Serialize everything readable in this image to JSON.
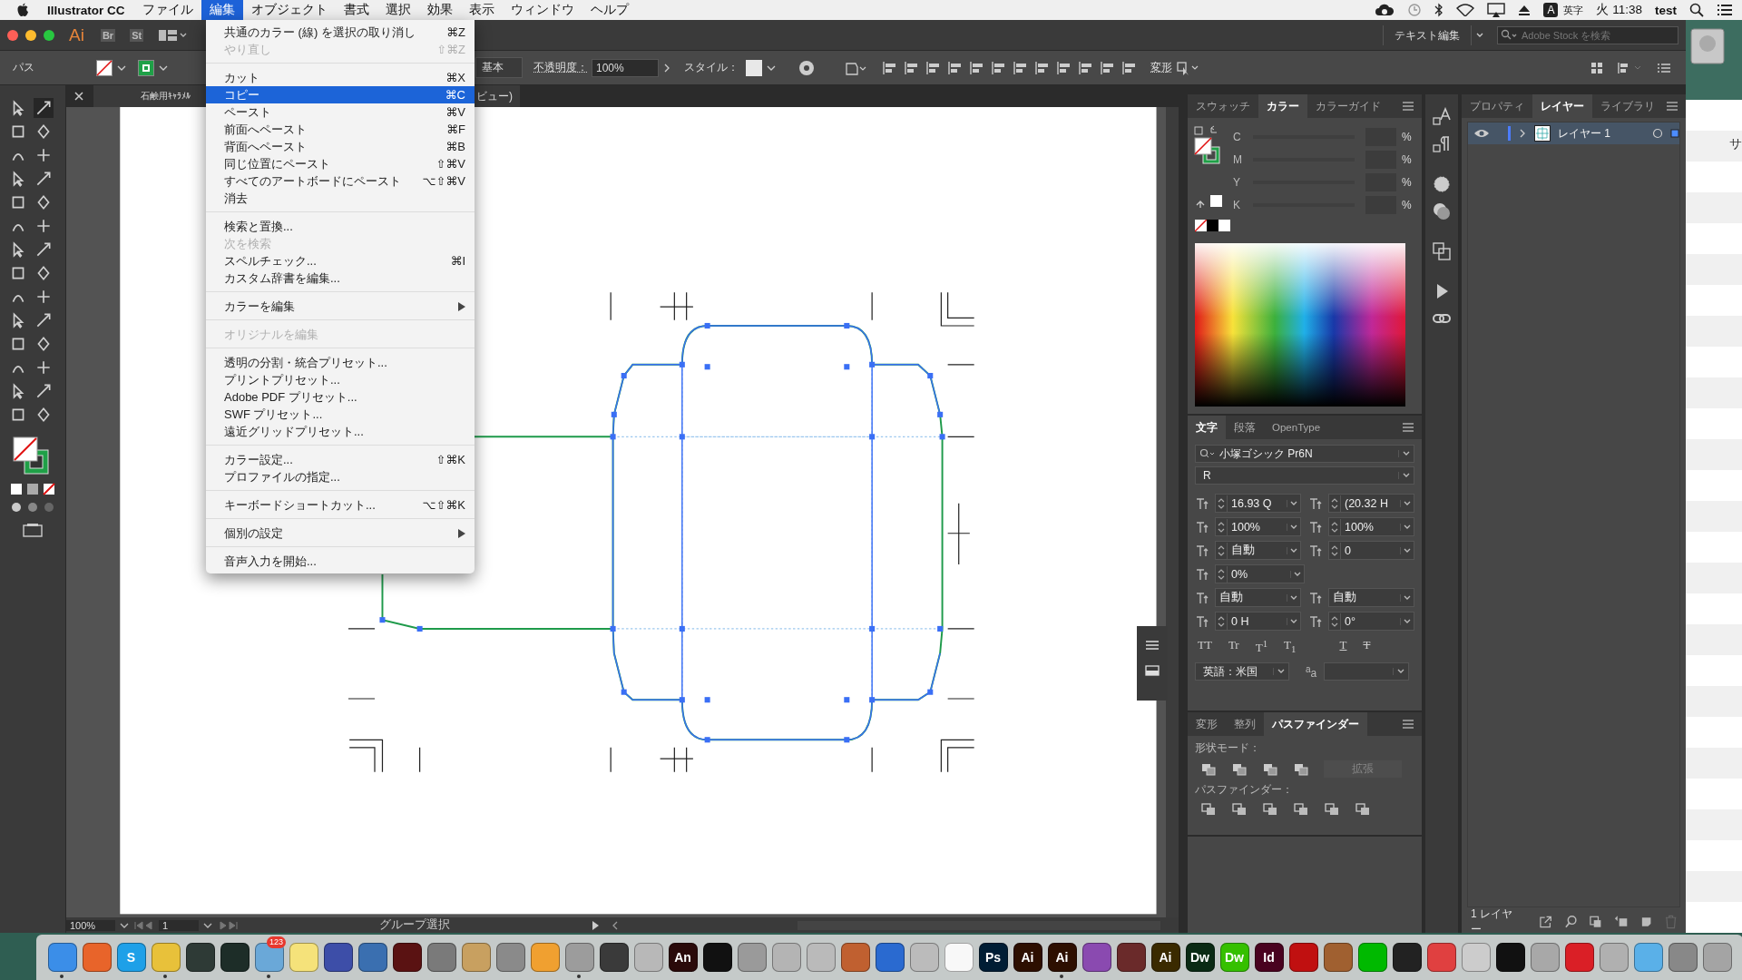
{
  "menubar": {
    "app_name": "Illustrator CC",
    "menus": [
      {
        "label": "ファイル",
        "selected": false
      },
      {
        "label": "編集",
        "selected": true
      },
      {
        "label": "オブジェクト",
        "selected": false
      },
      {
        "label": "書式",
        "selected": false
      },
      {
        "label": "選択",
        "selected": false
      },
      {
        "label": "効果",
        "selected": false
      },
      {
        "label": "表示",
        "selected": false
      },
      {
        "label": "ウィンドウ",
        "selected": false
      },
      {
        "label": "ヘルプ",
        "selected": false
      }
    ],
    "input_badge": "A",
    "input_mode": "英字",
    "clock": "火 11:38",
    "user": "test"
  },
  "edit_menu": {
    "items": [
      {
        "kind": "item",
        "label": "共通のカラー (線) を選択の取り消し",
        "shortcut": "⌘Z",
        "disabled": false,
        "selected": false
      },
      {
        "kind": "item",
        "label": "やり直し",
        "shortcut": "⇧⌘Z",
        "disabled": true,
        "selected": false
      },
      {
        "kind": "separator"
      },
      {
        "kind": "item",
        "label": "カット",
        "shortcut": "⌘X",
        "disabled": false,
        "selected": false
      },
      {
        "kind": "item",
        "label": "コピー",
        "shortcut": "⌘C",
        "disabled": false,
        "selected": true
      },
      {
        "kind": "item",
        "label": "ペースト",
        "shortcut": "⌘V",
        "disabled": false,
        "selected": false
      },
      {
        "kind": "item",
        "label": "前面へペースト",
        "shortcut": "⌘F",
        "disabled": false,
        "selected": false
      },
      {
        "kind": "item",
        "label": "背面へペースト",
        "shortcut": "⌘B",
        "disabled": false,
        "selected": false
      },
      {
        "kind": "item",
        "label": "同じ位置にペースト",
        "shortcut": "⇧⌘V",
        "disabled": false,
        "selected": false
      },
      {
        "kind": "item",
        "label": "すべてのアートボードにペースト",
        "shortcut": "⌥⇧⌘V",
        "disabled": false,
        "selected": false
      },
      {
        "kind": "item",
        "label": "消去",
        "disabled": false,
        "selected": false
      },
      {
        "kind": "separator"
      },
      {
        "kind": "item",
        "label": "検索と置換...",
        "disabled": false,
        "selected": false
      },
      {
        "kind": "item",
        "label": "次を検索",
        "disabled": true,
        "selected": false
      },
      {
        "kind": "item",
        "label": "スペルチェック...",
        "shortcut": "⌘I",
        "disabled": false,
        "selected": false
      },
      {
        "kind": "item",
        "label": "カスタム辞書を編集...",
        "disabled": false,
        "selected": false
      },
      {
        "kind": "separator"
      },
      {
        "kind": "item",
        "label": "カラーを編集",
        "submenu": true,
        "disabled": false,
        "selected": false
      },
      {
        "kind": "separator"
      },
      {
        "kind": "item",
        "label": "オリジナルを編集",
        "disabled": true,
        "selected": false
      },
      {
        "kind": "separator"
      },
      {
        "kind": "item",
        "label": "透明の分割・統合プリセット...",
        "disabled": false,
        "selected": false
      },
      {
        "kind": "item",
        "label": "プリントプリセット...",
        "disabled": false,
        "selected": false
      },
      {
        "kind": "item",
        "label": "Adobe PDF プリセット...",
        "disabled": false,
        "selected": false
      },
      {
        "kind": "item",
        "label": "SWF プリセット...",
        "disabled": false,
        "selected": false
      },
      {
        "kind": "item",
        "label": "遠近グリッドプリセット...",
        "disabled": false,
        "selected": false
      },
      {
        "kind": "separator"
      },
      {
        "kind": "item",
        "label": "カラー設定...",
        "shortcut": "⇧⌘K",
        "disabled": false,
        "selected": false
      },
      {
        "kind": "item",
        "label": "プロファイルの指定...",
        "disabled": false,
        "selected": false
      },
      {
        "kind": "separator"
      },
      {
        "kind": "item",
        "label": "キーボードショートカット...",
        "shortcut": "⌥⇧⌘K",
        "disabled": false,
        "selected": false
      },
      {
        "kind": "separator"
      },
      {
        "kind": "item",
        "label": "個別の設定",
        "submenu": true,
        "disabled": false,
        "selected": false
      },
      {
        "kind": "separator"
      },
      {
        "kind": "item",
        "label": "音声入力を開始...",
        "disabled": false,
        "selected": false
      }
    ]
  },
  "title_bar": {
    "app_badge": "Ai",
    "bridge": "Br",
    "stock": "St",
    "workspace": "テキスト編集",
    "search": {
      "placeholder": "Adobe Stock を検索"
    }
  },
  "control_bar": {
    "selection_label": "パス",
    "brush": "基本",
    "opacity_label": "不透明度：",
    "opacity": "100%",
    "style_label": "スタイル：",
    "transform": "変形"
  },
  "document": {
    "title_start": "石鹸用ｷｬﾗﾒﾙ",
    "title_end": "ビュー)"
  },
  "status_bar": {
    "zoom": "100%",
    "artboard": "1",
    "tool": "グループ選択"
  },
  "color_panel": {
    "tabs": [
      {
        "label": "スウォッチ",
        "selected": false
      },
      {
        "label": "カラー",
        "selected": true
      },
      {
        "label": "カラーガイド",
        "selected": false
      }
    ],
    "channels": [
      {
        "name": "C",
        "unit": "%"
      },
      {
        "name": "M",
        "unit": "%"
      },
      {
        "name": "Y",
        "unit": "%"
      },
      {
        "name": "K",
        "unit": "%"
      }
    ]
  },
  "character_panel": {
    "tabs": [
      {
        "label": "文字",
        "selected": true
      },
      {
        "label": "段落",
        "selected": false
      },
      {
        "label": "OpenType",
        "selected": false
      }
    ],
    "font_family": "小塚ゴシック Pr6N",
    "font_style": "R",
    "fields": [
      {
        "kind": "spin",
        "value": "16.93 Q"
      },
      {
        "kind": "spin",
        "value": "(20.32 H"
      },
      {
        "kind": "spin",
        "value": "100%"
      },
      {
        "kind": "spin",
        "value": "100%"
      },
      {
        "kind": "spin",
        "value": "自動"
      },
      {
        "kind": "spin",
        "value": "0"
      },
      {
        "kind": "spin",
        "value": "0%"
      },
      {
        "kind": "select",
        "value": "自動"
      },
      {
        "kind": "select",
        "value": "自動"
      },
      {
        "kind": "spin",
        "value": "0 H"
      },
      {
        "kind": "spin",
        "value": "0°"
      }
    ],
    "style_buttons": [
      "TT",
      "Tr",
      "T$^{1}$",
      "T$_{1}$",
      "T",
      "T"
    ],
    "language": "英語：米国",
    "antialias_label": "$^{a}$a"
  },
  "pathfinder_panel": {
    "tabs": [
      {
        "label": "変形",
        "selected": false
      },
      {
        "label": "整列",
        "selected": false
      },
      {
        "label": "パスファインダー",
        "selected": true
      }
    ],
    "shape_modes_label": "形状モード：",
    "expand_button": "拡張",
    "pathfinders_label": "パスファインダー："
  },
  "layers_panel": {
    "tabs": [
      {
        "label": "プロパティ",
        "selected": false
      },
      {
        "label": "レイヤー",
        "selected": true
      },
      {
        "label": "ライブラリ",
        "selected": false
      }
    ],
    "layers": [
      {
        "name": "レイヤー 1",
        "visible": true,
        "selected": true
      }
    ],
    "footer": "1 レイヤー"
  },
  "desktop": {
    "window_text": "サ"
  },
  "dock": {
    "items": [
      {
        "color": "#3b8ee8",
        "running": true
      },
      {
        "color": "#e8642a",
        "running": false
      },
      {
        "color": "#1ea0e8",
        "label": "S",
        "running": false
      },
      {
        "color": "#e8c13a",
        "running": true
      },
      {
        "color": "#2e3a36",
        "running": false
      },
      {
        "color": "#1d2d28",
        "running": false
      },
      {
        "color": "#6aa8d8",
        "badge": "123",
        "running": true
      },
      {
        "color": "#f5e27a",
        "running": false
      },
      {
        "color": "#3d4ea8",
        "running": false
      },
      {
        "color": "#3a6fb0",
        "running": false
      },
      {
        "color": "#5a1212",
        "running": false
      },
      {
        "color": "#7a7a7a",
        "running": false
      },
      {
        "color": "#c8a060",
        "running": false
      },
      {
        "color": "#8a8a8a",
        "running": false
      },
      {
        "color": "#f0a030",
        "running": false
      },
      {
        "color": "#9c9c9c",
        "running": true
      },
      {
        "color": "#3a3a3a",
        "running": false
      },
      {
        "color": "#b8b8b8",
        "running": false
      },
      {
        "color": "#2a0a0a",
        "label": "An",
        "running": false
      },
      {
        "color": "#111111",
        "running": false
      },
      {
        "color": "#9a9a9a",
        "running": false
      },
      {
        "color": "#b4b4b4",
        "running": false
      },
      {
        "color": "#bababa",
        "running": false
      },
      {
        "color": "#c06030",
        "running": false
      },
      {
        "color": "#2a6ad0",
        "running": false
      },
      {
        "color": "#bbbbbb",
        "running": false
      },
      {
        "color": "#f8f8f8",
        "running": false
      },
      {
        "color": "#001d34",
        "label": "Ps",
        "running": false
      },
      {
        "color": "#2d0f00",
        "label": "Ai",
        "running": false
      },
      {
        "color": "#2d0f00",
        "label": "Ai",
        "running": true
      },
      {
        "color": "#8a4ab0",
        "running": false
      },
      {
        "color": "#6a2a2a",
        "running": false
      },
      {
        "color": "#3a2a00",
        "label": "Ai",
        "running": false
      },
      {
        "color": "#0a2a14",
        "label": "Dw",
        "running": false
      },
      {
        "color": "#35c000",
        "label": "Dw",
        "running": false
      },
      {
        "color": "#49021f",
        "label": "Id",
        "running": false
      },
      {
        "color": "#c01010",
        "running": false
      },
      {
        "color": "#a06030",
        "running": false
      },
      {
        "color": "#00b900",
        "running": false
      },
      {
        "color": "#222222",
        "running": false
      },
      {
        "color": "#e04040",
        "running": false
      },
      {
        "color": "#cccccc",
        "running": false
      },
      {
        "color": "#111111",
        "running": false
      },
      {
        "color": "#a8a8a8",
        "running": false
      },
      {
        "color": "#da1f26",
        "running": false
      },
      {
        "color": "#b0b0b0",
        "running": false
      },
      {
        "color": "#5ab0e8",
        "running": false
      },
      {
        "color": "#888888",
        "running": false
      },
      {
        "color": "#a4a4a4",
        "running": false
      }
    ]
  }
}
